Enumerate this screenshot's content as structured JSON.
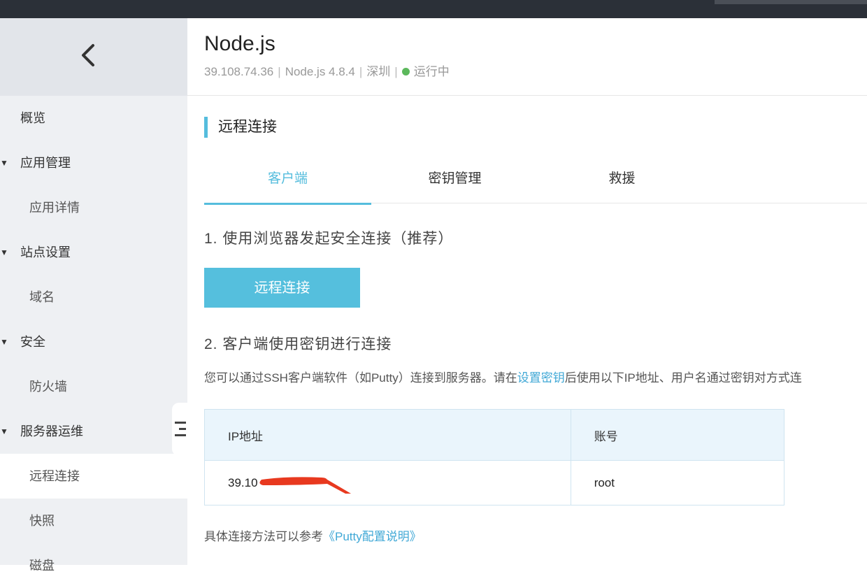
{
  "sidebar": {
    "items": [
      {
        "label": "概览"
      },
      {
        "label": "应用管理"
      },
      {
        "label": "应用详情"
      },
      {
        "label": "站点设置"
      },
      {
        "label": "域名"
      },
      {
        "label": "安全"
      },
      {
        "label": "防火墙"
      },
      {
        "label": "服务器运维"
      },
      {
        "label": "远程连接"
      },
      {
        "label": "快照"
      },
      {
        "label": "磁盘"
      }
    ]
  },
  "header": {
    "title": "Node.js",
    "ip": "39.108.74.36",
    "runtime": "Node.js  4.8.4",
    "region": "深圳",
    "status": "运行中",
    "status_color": "#5cb85c"
  },
  "section": {
    "title": "远程连接"
  },
  "tabs": [
    {
      "label": "客户端",
      "active": true
    },
    {
      "label": "密钥管理",
      "active": false
    },
    {
      "label": "救援",
      "active": false
    }
  ],
  "steps": {
    "step1": "1. 使用浏览器发起安全连接（推荐）",
    "connect_button": "远程连接",
    "step2": "2. 客户端使用密钥进行连接",
    "desc_before": "您可以通过SSH客户端软件（如Putty）连接到服务器。请在",
    "desc_link": "设置密钥",
    "desc_after": "后使用以下IP地址、用户名通过密钥对方式连"
  },
  "table": {
    "headers": [
      "IP地址",
      "账号"
    ],
    "rows": [
      [
        "39.10",
        "root"
      ]
    ]
  },
  "footer": {
    "text": "具体连接方法可以参考",
    "link": "《Putty配置说明》"
  },
  "colors": {
    "accent": "#55bddd",
    "button": "#55bfdd",
    "link": "#40a8d6"
  }
}
